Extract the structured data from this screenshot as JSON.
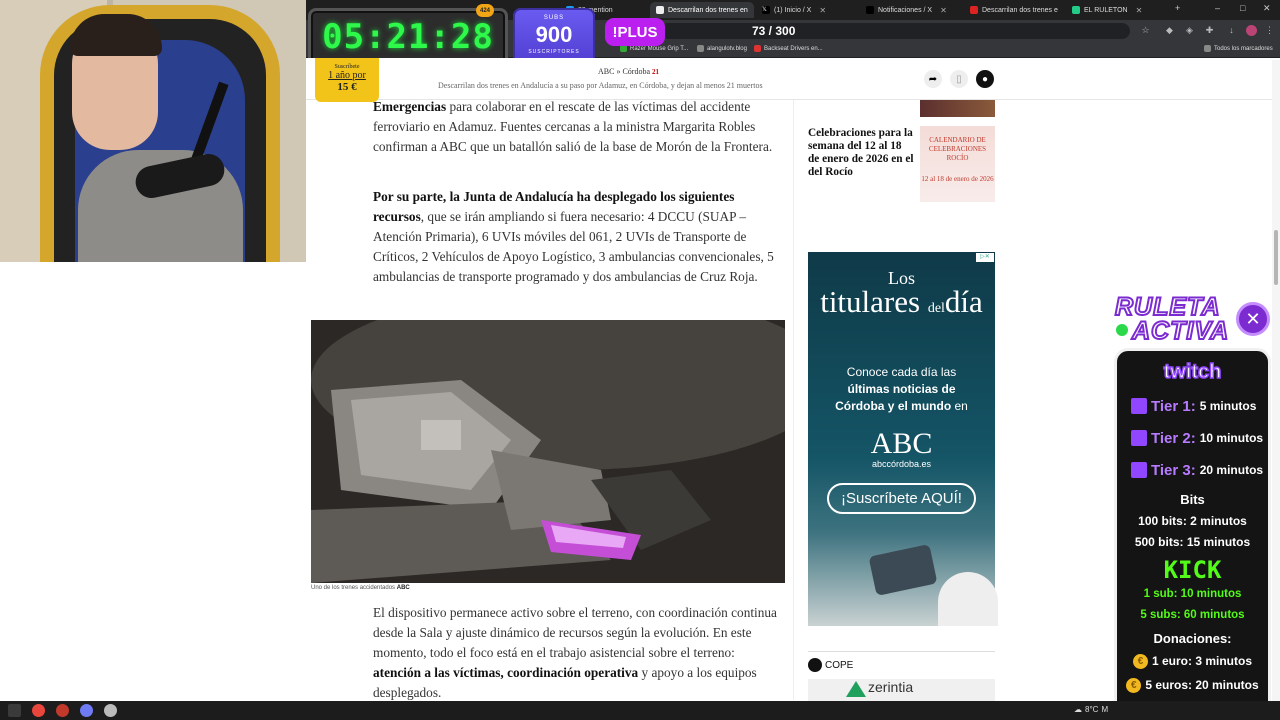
{
  "browser": {
    "tabs": [
      {
        "label": "39 mention",
        "color": "#1d9bf0"
      },
      {
        "label": "Descarrilan dos trenes en",
        "color": "#ffffff",
        "active": true
      },
      {
        "label": "(1) Inicio / X",
        "color": "#ffffff"
      },
      {
        "label": "Notificaciones / X",
        "color": "#ffffff"
      },
      {
        "label": "Descarrilan dos trenes e",
        "color": "#d22"
      },
      {
        "label": "EL RULETON",
        "color": "#2c8"
      }
    ],
    "bookmarks": [
      "Razer Mouse Grip T...",
      "alangulotv.blog",
      "Backseat Drivers en..."
    ],
    "bookmarks_right": "Todos los marcadores"
  },
  "overlay": {
    "timer": "05:21:28",
    "timer_badge": "424",
    "subs_label": "SUBS",
    "subs_count": "900",
    "subs_sub": "SUSCRIPTORES",
    "plus": "!PLUS",
    "counter": "73 / 300"
  },
  "page": {
    "logo": "ABC",
    "logo_sep": "»",
    "logo_city": "Córdoba",
    "logo_badge": "21",
    "header_title": "Descarrilan dos trenes en Andalucía a su paso por Adamuz, en Córdoba, y dejan al menos 21 muertos",
    "subscribe": {
      "line1": "Suscríbete",
      "line2": "1 año por",
      "price": "15 €"
    }
  },
  "article": {
    "p1_bold": "Emergencias",
    "p1_rest": " para colaborar en el rescate de las víctimas del accidente ferroviario en Adamuz. Fuentes cercanas a la ministra Margarita Robles confirman a ABC que un batallón salió de la base de Morón de la Frontera.",
    "p2_bold": "Por su parte, la Junta de Andalucía ha desplegado los siguientes recursos",
    "p2_rest": ", que se irán ampliando si fuera necesario: 4 DCCU (SUAP – Atención Primaria), 6 UVIs móviles del 061, 2 UVIs de Transporte de Críticos, 2 Vehículos de Apoyo Logístico, 3 ambulancias convencionales, 5 ambulancias de transporte programado y dos ambulancias de Cruz Roja.",
    "caption": "Uno de los trenes accidentados",
    "caption_credit": "ABC",
    "p3_a": "El dispositivo permanece activo sobre el terreno, con coordinación continua desde la Sala y ajuste dinámico de recursos según la evolución. En este momento, todo el foco está en el trabajo asistencial sobre el terreno: ",
    "p3_bold1": "atención a las víctimas, coordinación operativa",
    "p3_b": " y apoyo a los equipos desplegados."
  },
  "sidebar": {
    "story_title": "Celebraciones para la semana del 12 al 18 de enero de 2026 en el del Rocío",
    "thumb_title": "CALENDARIO DE CELEBRACIONES ROCÍO",
    "thumb_dates": "12 al 18 de enero de 2026",
    "ad": {
      "l1": "Los",
      "l2": "titulares",
      "l2b": "del",
      "l2c": "día",
      "body1": "Conoce cada día las",
      "body2": "últimas noticias de",
      "body3": "Córdoba y el mundo",
      "body4": " en",
      "brand": "ABC",
      "url": "abccórdoba.es",
      "cta": "¡Suscríbete AQUÍ!"
    },
    "cope": "COPE",
    "zerintia": "zerintia"
  },
  "roulette": {
    "title1": "RULETA",
    "title2": "ACTIVA",
    "twitch": "twitch",
    "tiers": [
      {
        "name": "Tier 1:",
        "value": "5 minutos"
      },
      {
        "name": "Tier 2:",
        "value": "10 minutos"
      },
      {
        "name": "Tier 3:",
        "value": "20 minutos"
      }
    ],
    "bits_header": "Bits",
    "bits": [
      "100 bits: 2 minutos",
      "500 bits: 15 minutos"
    ],
    "kick": "KICK",
    "kick_lines": [
      "1 sub: 10 minutos",
      "5 subs: 60 minutos"
    ],
    "donations_header": "Donaciones:",
    "donations": [
      "1 euro: 3 minutos",
      "5 euros: 20 minutos"
    ]
  },
  "taskbar": {
    "weather": "8°C",
    "weather_extra": "M"
  }
}
